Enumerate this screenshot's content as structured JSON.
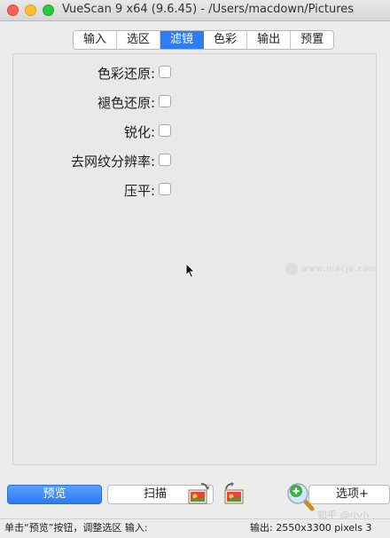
{
  "window": {
    "title": "VueScan 9 x64 (9.6.45) - /Users/macdown/Pictures"
  },
  "tabs": [
    {
      "label": "输入"
    },
    {
      "label": "选区"
    },
    {
      "label": "滤镜",
      "active": true
    },
    {
      "label": "色彩"
    },
    {
      "label": "输出"
    },
    {
      "label": "预置"
    }
  ],
  "filters": [
    {
      "label": "色彩还原:",
      "checked": false
    },
    {
      "label": "褪色还原:",
      "checked": false
    },
    {
      "label": "锐化:",
      "checked": false
    },
    {
      "label": "去网纹分辨率:",
      "checked": false
    },
    {
      "label": "压平:",
      "checked": false
    }
  ],
  "watermark": {
    "text": "www.macjo.com",
    "zh_text": "知乎 @小小"
  },
  "buttons": {
    "preview": "预览",
    "scan": "扫描",
    "options": "选项+"
  },
  "status": {
    "left": "单击“预览”按钮，调整选区 输入:",
    "right": "输出: 2550x3300 pixels 3"
  },
  "colors": {
    "accent": "#2d7cf6",
    "close": "#fe5f57",
    "minimize": "#febc2e",
    "maximize": "#28c840"
  },
  "icons": [
    "close-icon",
    "minimize-icon",
    "maximize-icon",
    "mouse-cursor-icon",
    "photo-scan-icon",
    "photo-scan-icon",
    "zoom-plus-icon"
  ]
}
